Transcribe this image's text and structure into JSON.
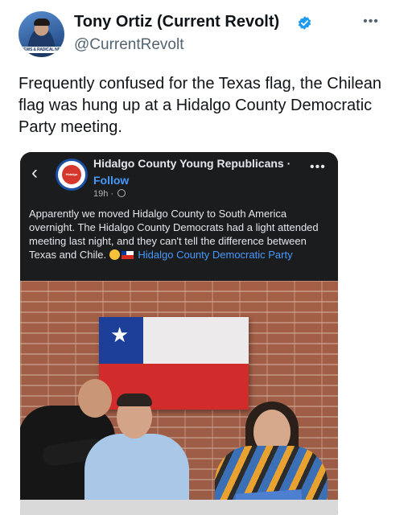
{
  "tweet": {
    "author_name": "Tony Ortiz (Current Revolt)",
    "author_handle": "@CurrentRevolt",
    "avatar_banner_text": "NEWS & RADICAL NEWS",
    "more_label": "•••",
    "text": "Frequently confused for the Texas flag, the Chilean flag was hung up at a Hidalgo County Democratic Party meeting."
  },
  "embedded_post": {
    "back_label": "‹",
    "page_name": "Hidalgo County Young Republicans ·",
    "follow_label": "Follow",
    "time": "19h ·",
    "more_label": "•••",
    "body_text": "Apparently we moved Hidalgo County to South America overnight. The Hidalgo County Democrats had a light attended meeting last night, and they can't tell the difference between Texas and Chile.",
    "link_text": "Hidalgo County Democratic Party",
    "avatar_text": "Hidalgo"
  },
  "colors": {
    "verified_blue": "#1d9bf0",
    "link_blue": "#4599ff",
    "flag_red": "#d12b2b",
    "flag_blue": "#1d3f9a"
  },
  "icons": {
    "verified": "verified-badge-icon",
    "globe": "globe-icon",
    "back": "back-arrow-icon",
    "star": "star-icon"
  }
}
